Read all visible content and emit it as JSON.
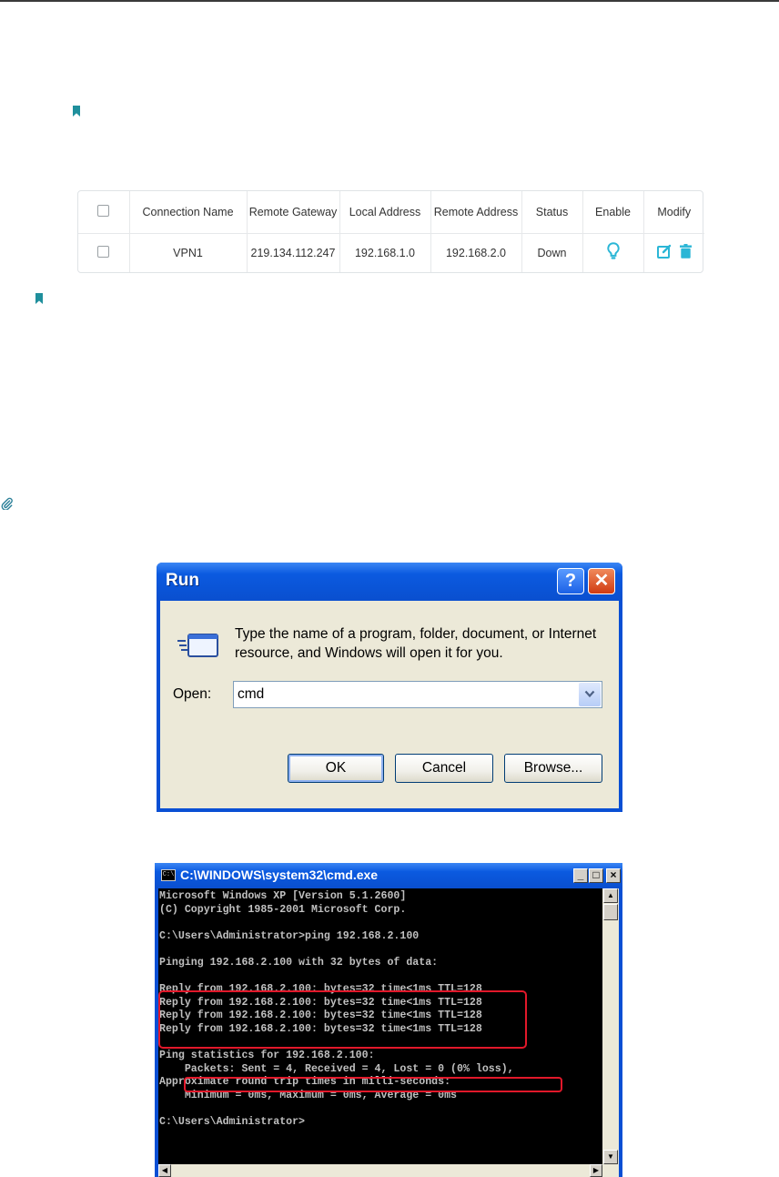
{
  "vpn_table": {
    "headers": [
      "",
      "Connection Name",
      "Remote Gateway",
      "Local Address",
      "Remote Address",
      "Status",
      "Enable",
      "Modify"
    ],
    "rows": [
      {
        "connection_name": "VPN1",
        "remote_gateway": "219.134.112.247",
        "local_address": "192.168.1.0",
        "remote_address": "192.168.2.0",
        "status": "Down"
      }
    ]
  },
  "icons": {
    "note": "bookmark-icon",
    "tips": "paperclip-icon",
    "enable": "lightbulb-icon",
    "edit": "edit-icon",
    "delete": "trash-icon",
    "run": "run-icon",
    "help": "help-icon",
    "close": "close-icon",
    "dropdown": "chevron-down-icon"
  },
  "colors": {
    "accent": "#2bb6d6",
    "highlight": "#e1182a",
    "xp_blue": "#0a4fd4"
  },
  "run_dialog": {
    "title": "Run",
    "help_label": "?",
    "close_label": "✕",
    "description": "Type the name of a program, folder, document, or Internet resource, and Windows will open it for you.",
    "open_label": "Open:",
    "open_value": "cmd",
    "ok_label": "OK",
    "cancel_label": "Cancel",
    "browse_label": "Browse..."
  },
  "cmd_window": {
    "title": "C:\\WINDOWS\\system32\\cmd.exe",
    "sys_icon_label": "C:\\",
    "min_label": "_",
    "max_label": "□",
    "close_label": "×",
    "lines": [
      "Microsoft Windows XP [Version 5.1.2600]",
      "(C) Copyright 1985-2001 Microsoft Corp.",
      "",
      "C:\\Users\\Administrator>ping 192.168.2.100",
      "",
      "Pinging 192.168.2.100 with 32 bytes of data:",
      "",
      "Reply from 192.168.2.100: bytes=32 time<1ms TTL=128",
      "Reply from 192.168.2.100: bytes=32 time<1ms TTL=128",
      "Reply from 192.168.2.100: bytes=32 time<1ms TTL=128",
      "Reply from 192.168.2.100: bytes=32 time<1ms TTL=128",
      "",
      "Ping statistics for 192.168.2.100:",
      "    Packets: Sent = 4, Received = 4, Lost = 0 (0% loss),",
      "Approximate round trip times in milli-seconds:",
      "    Minimum = 0ms, Maximum = 0ms, Average = 0ms",
      "",
      "C:\\Users\\Administrator>"
    ]
  }
}
